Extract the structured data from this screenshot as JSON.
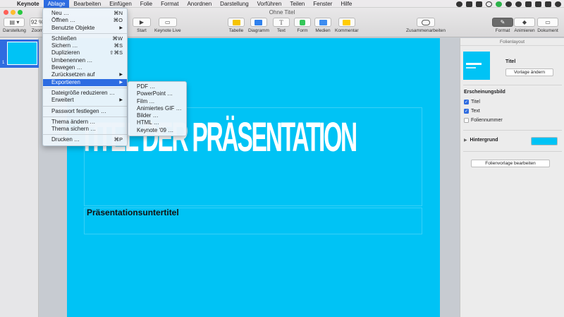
{
  "menubar": {
    "app": "Keynote",
    "items": [
      "Ablage",
      "Bearbeiten",
      "Einfügen",
      "Folie",
      "Format",
      "Anordnen",
      "Darstellung",
      "Vorführen",
      "Teilen",
      "Fenster",
      "Hilfe"
    ]
  },
  "window": {
    "title": "Ohne Titel"
  },
  "toolbar": {
    "view_label": "Darstellung",
    "zoom_value": "92 %",
    "zoom_label": "Zoom",
    "play_label": "Start",
    "keynote_live_label": "Keynote Live",
    "table_label": "Tabelle",
    "chart_label": "Diagramm",
    "text_label": "Text",
    "shape_label": "Form",
    "media_label": "Medien",
    "comment_label": "Kommentar",
    "collaborate_label": "Zusammenarbeiten",
    "format_label": "Format",
    "animate_label": "Animieren",
    "document_label": "Dokument"
  },
  "navigator": {
    "slide_number": "1"
  },
  "slide": {
    "title": "TITEL DER PRÄSENTATION",
    "subtitle": "Präsentationsuntertitel",
    "background_color": "#00c3f5"
  },
  "inspector": {
    "header": "Folienlayout",
    "layout_name": "Titel",
    "change_template_button": "Vorlage ändern",
    "appearance_heading": "Erscheinungsbild",
    "checkboxes": [
      {
        "label": "Titel",
        "checked": true
      },
      {
        "label": "Text",
        "checked": true
      },
      {
        "label": "Foliennummer",
        "checked": false
      }
    ],
    "background_label": "Hintergrund",
    "edit_layout_button": "Folienvorlage bearbeiten"
  },
  "file_menu": {
    "items": [
      {
        "label": "Neu …",
        "shortcut": "⌘N"
      },
      {
        "label": "Öffnen …",
        "shortcut": "⌘O"
      },
      {
        "label": "Benutzte Objekte",
        "submenu": true
      },
      {
        "label": "Schließen",
        "shortcut": "⌘W"
      },
      {
        "label": "Sichern …",
        "shortcut": "⌘S"
      },
      {
        "label": "Duplizieren",
        "shortcut": "⇧⌘S"
      },
      {
        "label": "Umbenennen …"
      },
      {
        "label": "Bewegen …"
      },
      {
        "label": "Zurücksetzen auf",
        "submenu": true
      },
      {
        "label": "Exportieren",
        "submenu": true
      },
      {
        "label": "Dateigröße reduzieren …"
      },
      {
        "label": "Erweitert",
        "submenu": true
      },
      {
        "label": "Passwort festlegen …"
      },
      {
        "label": "Thema ändern …"
      },
      {
        "label": "Thema sichern …"
      },
      {
        "label": "Drucken …",
        "shortcut": "⌘P"
      }
    ]
  },
  "export_submenu": {
    "items": [
      "PDF …",
      "PowerPoint …",
      "Film …",
      "Animiertes GIF …",
      "Bilder …",
      "HTML …",
      "Keynote '09 …"
    ]
  }
}
